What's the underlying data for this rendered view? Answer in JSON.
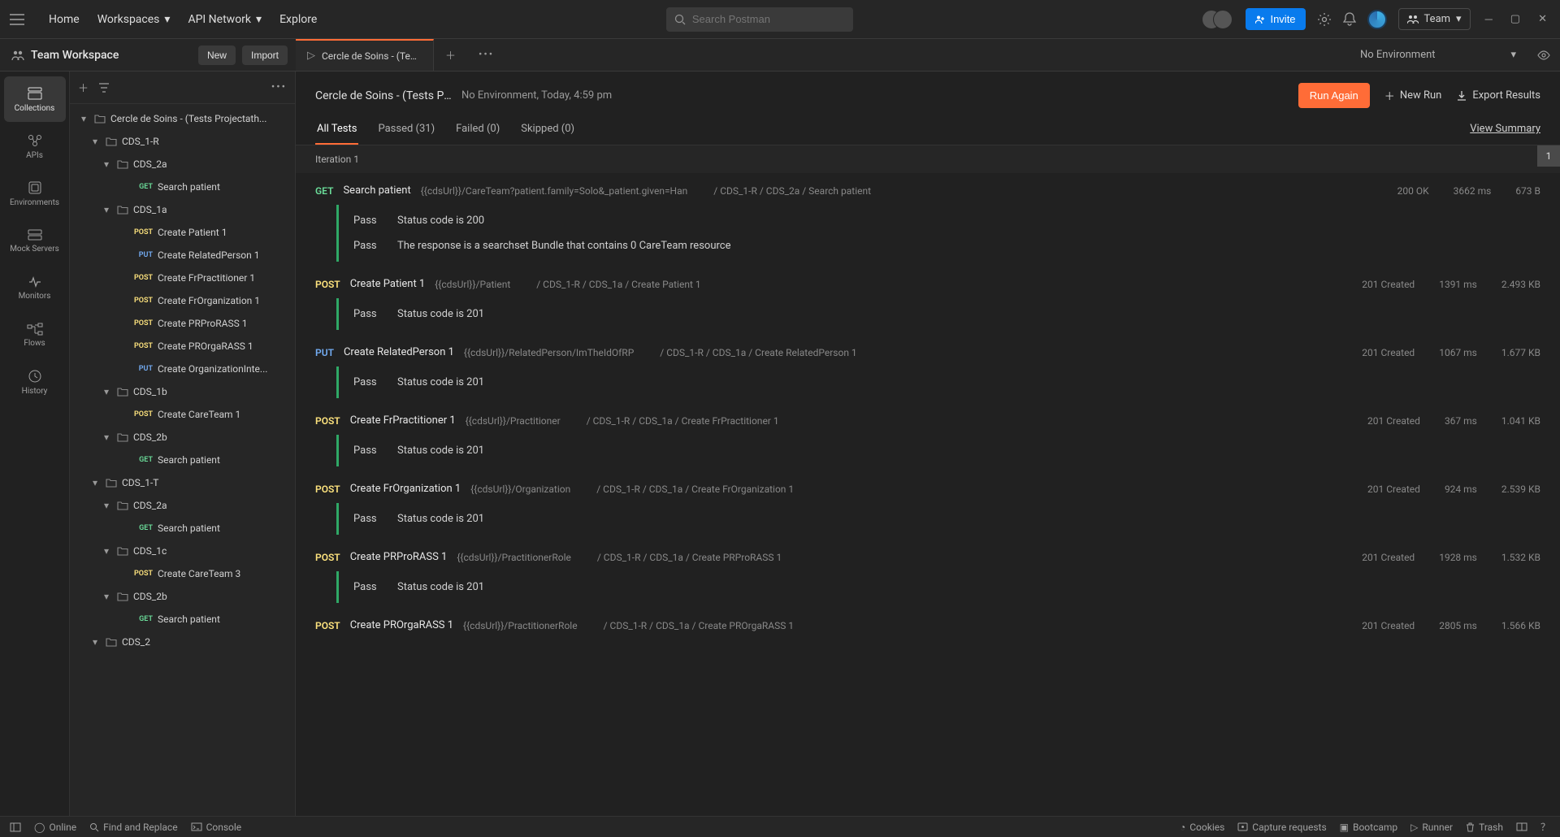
{
  "header": {
    "nav": [
      "Home",
      "Workspaces",
      "API Network",
      "Explore"
    ],
    "search_placeholder": "Search Postman",
    "invite": "Invite",
    "team_label": "Team"
  },
  "workspace": {
    "name": "Team Workspace",
    "new_btn": "New",
    "import_btn": "Import"
  },
  "tabs": {
    "open": "Cercle de Soins - (Tests P",
    "env": "No Environment"
  },
  "rail": [
    {
      "id": "collections",
      "label": "Collections"
    },
    {
      "id": "apis",
      "label": "APIs"
    },
    {
      "id": "environments",
      "label": "Environments"
    },
    {
      "id": "mockservers",
      "label": "Mock Servers"
    },
    {
      "id": "monitors",
      "label": "Monitors"
    },
    {
      "id": "flows",
      "label": "Flows"
    },
    {
      "id": "history",
      "label": "History"
    }
  ],
  "tree": [
    {
      "depth": 0,
      "type": "folder",
      "open": true,
      "label": "Cercle de Soins - (Tests Projectath..."
    },
    {
      "depth": 1,
      "type": "folder",
      "open": true,
      "label": "CDS_1-R"
    },
    {
      "depth": 2,
      "type": "folder",
      "open": true,
      "label": "CDS_2a"
    },
    {
      "depth": 3,
      "type": "req",
      "method": "GET",
      "label": "Search patient"
    },
    {
      "depth": 2,
      "type": "folder",
      "open": true,
      "label": "CDS_1a"
    },
    {
      "depth": 3,
      "type": "req",
      "method": "POST",
      "label": "Create Patient 1"
    },
    {
      "depth": 3,
      "type": "req",
      "method": "PUT",
      "label": "Create RelatedPerson 1"
    },
    {
      "depth": 3,
      "type": "req",
      "method": "POST",
      "label": "Create FrPractitioner 1"
    },
    {
      "depth": 3,
      "type": "req",
      "method": "POST",
      "label": "Create FrOrganization 1"
    },
    {
      "depth": 3,
      "type": "req",
      "method": "POST",
      "label": "Create PRProRASS 1"
    },
    {
      "depth": 3,
      "type": "req",
      "method": "POST",
      "label": "Create PROrgaRASS 1"
    },
    {
      "depth": 3,
      "type": "req",
      "method": "PUT",
      "label": "Create OrganizationInte..."
    },
    {
      "depth": 2,
      "type": "folder",
      "open": true,
      "label": "CDS_1b"
    },
    {
      "depth": 3,
      "type": "req",
      "method": "POST",
      "label": "Create CareTeam 1"
    },
    {
      "depth": 2,
      "type": "folder",
      "open": true,
      "label": "CDS_2b"
    },
    {
      "depth": 3,
      "type": "req",
      "method": "GET",
      "label": "Search patient"
    },
    {
      "depth": 1,
      "type": "folder",
      "open": true,
      "label": "CDS_1-T"
    },
    {
      "depth": 2,
      "type": "folder",
      "open": true,
      "label": "CDS_2a"
    },
    {
      "depth": 3,
      "type": "req",
      "method": "GET",
      "label": "Search patient"
    },
    {
      "depth": 2,
      "type": "folder",
      "open": true,
      "label": "CDS_1c"
    },
    {
      "depth": 3,
      "type": "req",
      "method": "POST",
      "label": "Create CareTeam 3"
    },
    {
      "depth": 2,
      "type": "folder",
      "open": true,
      "label": "CDS_2b"
    },
    {
      "depth": 3,
      "type": "req",
      "method": "GET",
      "label": "Search patient"
    },
    {
      "depth": 1,
      "type": "folder",
      "open": true,
      "label": "CDS_2"
    }
  ],
  "run": {
    "title": "Cercle de Soins - (Tests Pr...",
    "subtitle": "No Environment, Today, 4:59 pm",
    "run_again": "Run Again",
    "new_run": "New Run",
    "export": "Export Results",
    "tabs": {
      "all": "All Tests",
      "passed": "Passed (31)",
      "failed": "Failed (0)",
      "skipped": "Skipped (0)"
    },
    "summary_link": "View Summary",
    "iteration_label": "Iteration 1",
    "iter_badge": "1"
  },
  "results": [
    {
      "method": "GET",
      "name": "Search patient",
      "url": "{{cdsUrl}}/CareTeam?patient.family=Solo&_patient.given=Han",
      "path": "/ CDS_1-R / CDS_2a / Search patient",
      "status": "200 OK",
      "time": "3662 ms",
      "size": "673 B",
      "asserts": [
        {
          "r": "Pass",
          "m": "Status code is 200"
        },
        {
          "r": "Pass",
          "m": "The response is a searchset Bundle that contains 0 CareTeam resource"
        }
      ]
    },
    {
      "method": "POST",
      "name": "Create Patient 1",
      "url": "{{cdsUrl}}/Patient",
      "path": "/ CDS_1-R / CDS_1a / Create Patient 1",
      "status": "201 Created",
      "time": "1391 ms",
      "size": "2.493 KB",
      "asserts": [
        {
          "r": "Pass",
          "m": "Status code is 201"
        }
      ]
    },
    {
      "method": "PUT",
      "name": "Create RelatedPerson 1",
      "url": "{{cdsUrl}}/RelatedPerson/ImTheIdOfRP",
      "path": "/ CDS_1-R / CDS_1a / Create RelatedPerson 1",
      "status": "201 Created",
      "time": "1067 ms",
      "size": "1.677 KB",
      "asserts": [
        {
          "r": "Pass",
          "m": "Status code is 201"
        }
      ]
    },
    {
      "method": "POST",
      "name": "Create FrPractitioner 1",
      "url": "{{cdsUrl}}/Practitioner",
      "path": "/ CDS_1-R / CDS_1a / Create FrPractitioner 1",
      "status": "201 Created",
      "time": "367 ms",
      "size": "1.041 KB",
      "asserts": [
        {
          "r": "Pass",
          "m": "Status code is 201"
        }
      ]
    },
    {
      "method": "POST",
      "name": "Create FrOrganization 1",
      "url": "{{cdsUrl}}/Organization",
      "path": "/ CDS_1-R / CDS_1a / Create FrOrganization 1",
      "status": "201 Created",
      "time": "924 ms",
      "size": "2.539 KB",
      "asserts": [
        {
          "r": "Pass",
          "m": "Status code is 201"
        }
      ]
    },
    {
      "method": "POST",
      "name": "Create PRProRASS 1",
      "url": "{{cdsUrl}}/PractitionerRole",
      "path": "/ CDS_1-R / CDS_1a / Create PRProRASS 1",
      "status": "201 Created",
      "time": "1928 ms",
      "size": "1.532 KB",
      "asserts": [
        {
          "r": "Pass",
          "m": "Status code is 201"
        }
      ]
    },
    {
      "method": "POST",
      "name": "Create PROrgaRASS 1",
      "url": "{{cdsUrl}}/PractitionerRole",
      "path": "/ CDS_1-R / CDS_1a / Create PROrgaRASS 1",
      "status": "201 Created",
      "time": "2805 ms",
      "size": "1.566 KB",
      "asserts": []
    }
  ],
  "footer": {
    "online": "Online",
    "find": "Find and Replace",
    "console": "Console",
    "cookies": "Cookies",
    "capture": "Capture requests",
    "bootcamp": "Bootcamp",
    "runner": "Runner",
    "trash": "Trash"
  }
}
